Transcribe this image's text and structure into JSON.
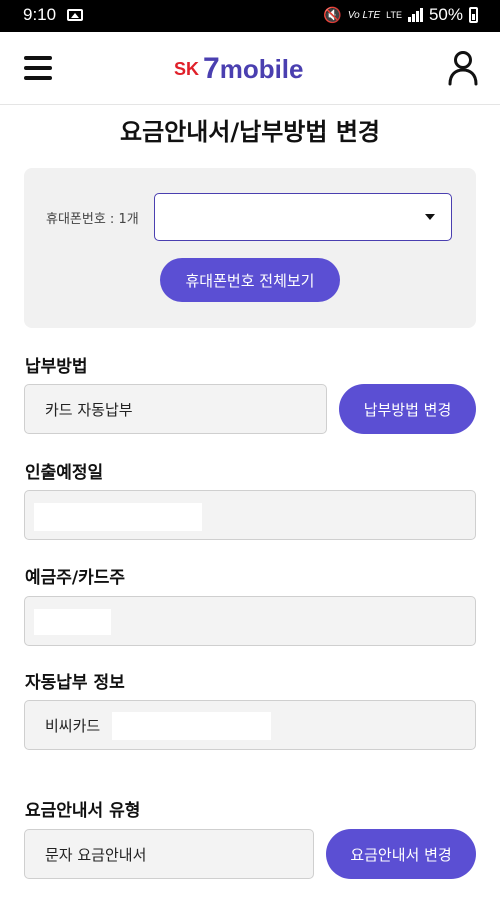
{
  "status_bar": {
    "time": "9:10",
    "volte": "Vo LTE",
    "lte": "LTE",
    "battery": "50%",
    "icons": [
      "image-icon",
      "mute-icon",
      "signal-icon",
      "battery-icon"
    ]
  },
  "header": {
    "logo_sk": "SK",
    "logo_seven": "7",
    "logo_mobile": "mobile",
    "brand_colors": {
      "sk": "#e0202a",
      "seven_mobile": "#4a3fb0"
    },
    "icons": [
      "hamburger-menu-icon",
      "user-icon"
    ]
  },
  "page": {
    "title": "요금안내서/납부방법 변경"
  },
  "phone_section": {
    "label": "휴대폰번호 : 1개",
    "select_value": "",
    "view_all_button": "휴대폰번호 전체보기"
  },
  "payment_method": {
    "label": "납부방법",
    "value": "카드 자동납부",
    "change_button": "납부방법 변경"
  },
  "withdrawal_date": {
    "label": "인출예정일",
    "value": ""
  },
  "account_holder": {
    "label": "예금주/카드주",
    "value": ""
  },
  "auto_payment_info": {
    "label": "자동납부 정보",
    "value": "비씨카드"
  },
  "bill_type": {
    "label": "요금안내서 유형",
    "value": "문자 요금안내서",
    "change_button": "요금안내서 변경"
  },
  "colors": {
    "accent": "#5b4fd3",
    "field_bg": "#f3f3f3",
    "card_bg": "#f1f1f1"
  }
}
